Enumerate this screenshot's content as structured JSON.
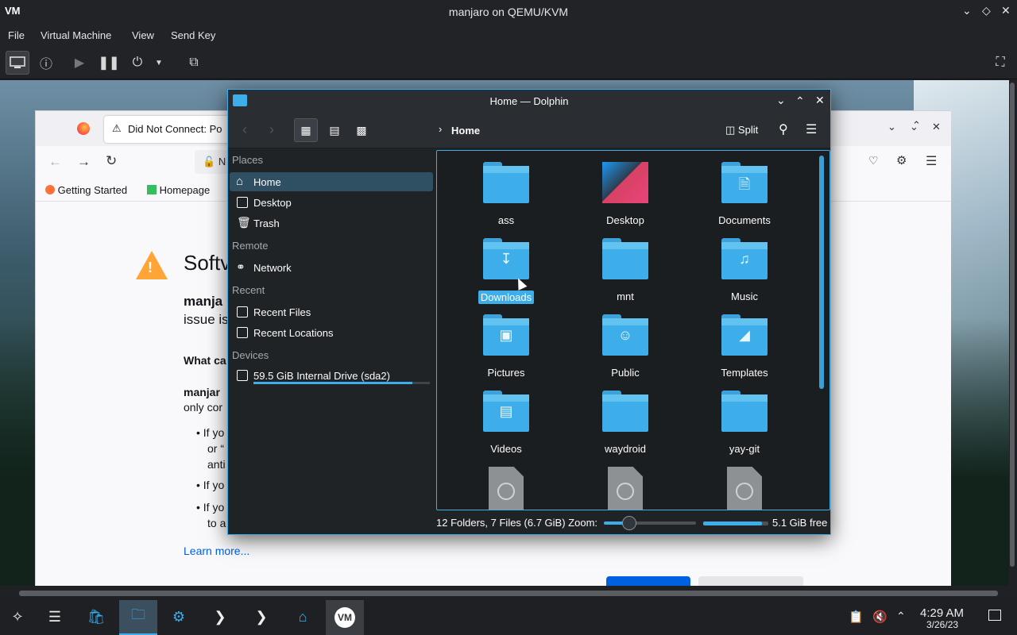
{
  "vmm": {
    "title": "manjaro on QEMU/KVM",
    "menu": [
      "File",
      "Virtual Machine",
      "View",
      "Send Key"
    ]
  },
  "firefox": {
    "tab_title": "Did Not Connect: Po",
    "url_partial": "N",
    "bookmarks": [
      "Getting Started",
      "Homepage"
    ],
    "heading": "Softv",
    "bold_line": "manja",
    "line2": "issue is",
    "what_can": "What ca",
    "manja2": "manjar",
    "only": "only cor",
    "bullets": [
      "If yo",
      "or “",
      "anti",
      "If yo",
      "If yo",
      "to a"
    ],
    "learn_more": "Learn more..."
  },
  "dolphin": {
    "title": "Home — Dolphin",
    "breadcrumb": "Home",
    "split_label": "Split",
    "places_sections": {
      "places": "Places",
      "remote": "Remote",
      "recent": "Recent",
      "devices": "Devices"
    },
    "places": [
      "Home",
      "Desktop",
      "Trash"
    ],
    "remote": [
      "Network"
    ],
    "recent": [
      "Recent Files",
      "Recent Locations"
    ],
    "devices": [
      "59.5 GiB Internal Drive (sda2)"
    ],
    "device_usage": 0.9,
    "items": [
      "ass",
      "Desktop",
      "Documents",
      "Downloads",
      "mnt",
      "Music",
      "Pictures",
      "Public",
      "Templates",
      "Videos",
      "waydroid",
      "yay-git"
    ],
    "status_text": "12 Folders, 7 Files (6.7 GiB) Zoom:",
    "zoom_fraction": 0.28,
    "free_space_label": "5.1 GiB free",
    "free_fraction": 0.9
  },
  "clock": {
    "time": "4:29 AM",
    "date": "3/26/23"
  },
  "colors": {
    "accent": "#3daee9",
    "selection": "#2f4f63"
  }
}
